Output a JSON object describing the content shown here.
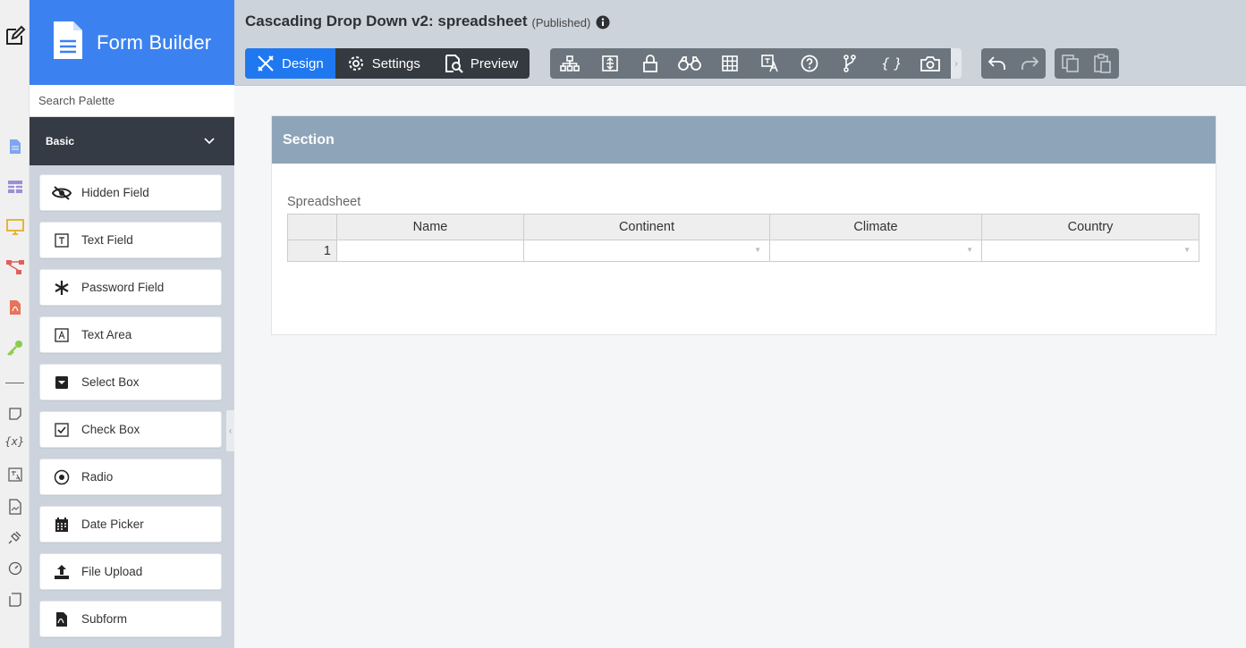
{
  "app": {
    "title": "Form Builder"
  },
  "palette": {
    "search_placeholder": "Search Palette",
    "group_label": "Basic",
    "items": [
      {
        "label": "Hidden Field",
        "icon": "eye-slash-icon"
      },
      {
        "label": "Text Field",
        "icon": "text-field-icon"
      },
      {
        "label": "Password Field",
        "icon": "asterisk-icon"
      },
      {
        "label": "Text Area",
        "icon": "text-area-icon"
      },
      {
        "label": "Select Box",
        "icon": "select-box-icon"
      },
      {
        "label": "Check Box",
        "icon": "check-box-icon"
      },
      {
        "label": "Radio",
        "icon": "radio-icon"
      },
      {
        "label": "Date Picker",
        "icon": "calendar-icon"
      },
      {
        "label": "File Upload",
        "icon": "upload-icon"
      },
      {
        "label": "Subform",
        "icon": "subform-icon"
      }
    ]
  },
  "header": {
    "form_title": "Cascading Drop Down v2: spreadsheet",
    "status": "(Published)",
    "modes": [
      {
        "label": "Design",
        "icon": "design-icon",
        "active": true
      },
      {
        "label": "Settings",
        "icon": "gear-icon",
        "active": false
      },
      {
        "label": "Preview",
        "icon": "preview-icon",
        "active": false
      }
    ],
    "tools": [
      "hierarchy-icon",
      "align-icon",
      "lock-icon",
      "binoculars-icon",
      "grid-icon",
      "translate-icon",
      "help-icon",
      "branch-icon",
      "braces-icon",
      "camera-icon"
    ]
  },
  "canvas": {
    "section_title": "Section",
    "spreadsheet": {
      "label": "Spreadsheet",
      "columns": [
        "Name",
        "Continent",
        "Climate",
        "Country"
      ],
      "rows": [
        [
          "1",
          "",
          "",
          "",
          ""
        ]
      ]
    }
  },
  "colors": {
    "brand": "#3b82f0",
    "active_mode": "#1f78f0",
    "section_header": "#8ea4b8",
    "toolbar": "#6c757d",
    "dark": "#343a40"
  }
}
